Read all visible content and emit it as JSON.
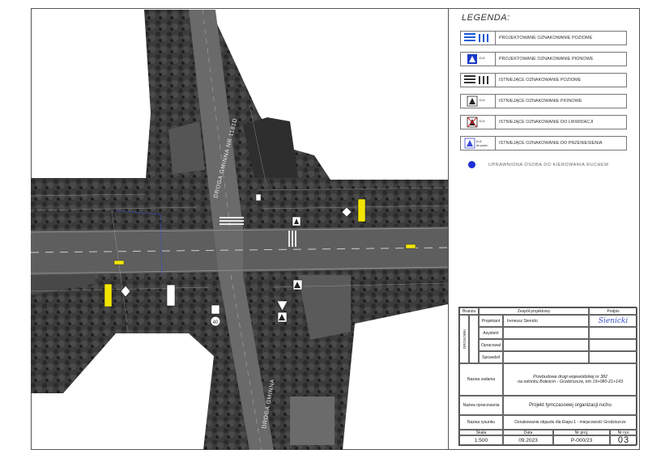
{
  "legend": {
    "title": "LEGENDA:",
    "items": [
      {
        "label": "PROJEKTOWANE OZNAKOWANIE POZIOME",
        "icon": "projected-horizontal-marking-icon"
      },
      {
        "label": "PROJEKTOWANE OZNAKOWANIE PIONOWE",
        "icon": "projected-vertical-sign-icon",
        "code": "D-6"
      },
      {
        "label": "ISTNIEJĄCE OZNAKOWANIE POZIOME",
        "icon": "existing-horizontal-marking-icon"
      },
      {
        "label": "ISTNIEJĄCE OZNAKOWANIE PIONOWE",
        "icon": "existing-vertical-sign-icon",
        "code": "D-6"
      },
      {
        "label": "ISTNIEJĄCE OZNAKOWANIE DO LIKWIDACJI",
        "icon": "sign-to-remove-icon",
        "code": "D-6"
      },
      {
        "label": "ISTNIEJĄCE OZNAKOWANIE DO PRZENIESIENIA",
        "icon": "sign-to-relocate-icon",
        "code": "D-6",
        "sub": "do przen."
      }
    ],
    "traffic_controller": {
      "label": "UPRAWNIONA OSOBA DO KIEROWANIA RUCHEM",
      "color": "#1d2fd6"
    }
  },
  "map_labels": {
    "road_north": "DROGA GMINNA NR 1181D",
    "road_south": "DROGA GMINNA"
  },
  "colors": {
    "sign_yellow": "#f2e600",
    "controller_blue": "#1d2fd6",
    "signature_blue": "#3e55c9"
  },
  "title_block": {
    "h_branza": "Branża",
    "h_zespol": "Zespół projektowy",
    "h_podpis": "Podpis",
    "section_label": "DROGOWA",
    "r_projektant": "Projektant",
    "designer_name": "Ireneusz Sienicki",
    "signature": "Sienicki",
    "r_asystent": "Asystent",
    "r_opracowal": "Opracował",
    "r_sprawdzil": "Sprawdził",
    "l_nazwa_zadania": "Nazwa zadania",
    "task_line1": "Przebudowa drogi wojewódzkiej nr 382",
    "task_line2": "na odcinku Boleścin - Grodziszcze, km 19+080-21+143",
    "l_nazwa_opracowania": "Nazwa opracowania",
    "study_name": "Projekt tymczasowej organizacji ruchu",
    "l_nazwa_rysunku": "Nazwa rysunku",
    "drawing_name": "Oznakowanie objazdu dla Etapu 1 - miejscowość Grodziszcze",
    "h_skala": "Skala",
    "h_data": "Data",
    "h_nr_proj": "Nr proj.",
    "h_nr_rys": "Nr rys.",
    "scale": "1:500",
    "date": "09.2023",
    "project_no": "P-000/23",
    "drawing_no": "03"
  }
}
